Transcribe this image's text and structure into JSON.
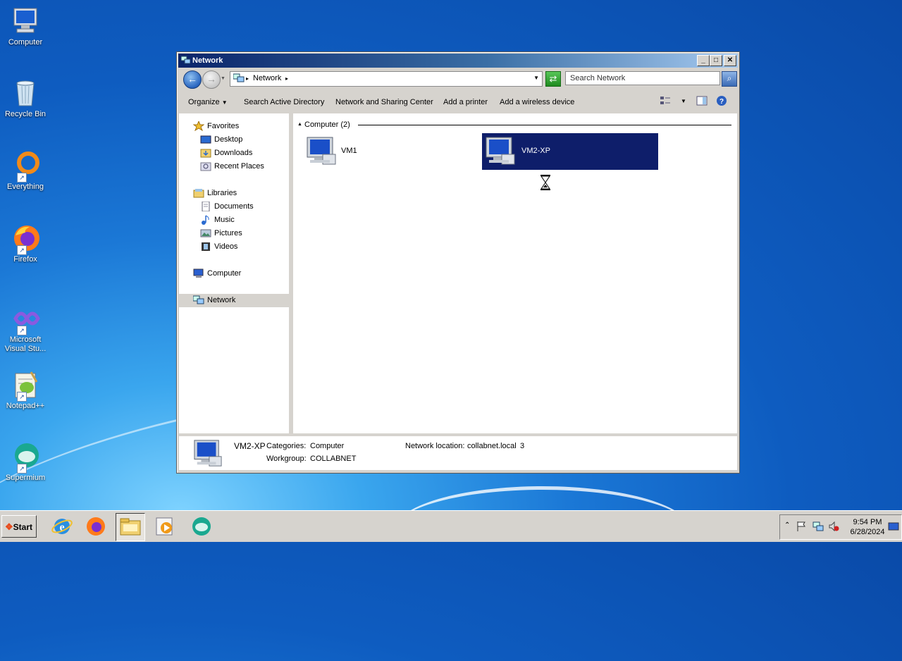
{
  "desktop": {
    "icons": [
      {
        "label": "Computer"
      },
      {
        "label": "Recycle Bin"
      },
      {
        "label": "Everything"
      },
      {
        "label": "Firefox"
      },
      {
        "label": "Microsoft Visual Stu..."
      },
      {
        "label": "Notepad++"
      },
      {
        "label": "Supermium"
      }
    ]
  },
  "window": {
    "title": "Network",
    "controls": {
      "minimize": "_",
      "maximize": "□",
      "close": "✕"
    },
    "address": {
      "breadcrumb": "Network",
      "search_placeholder": "Search Network"
    },
    "toolbar": {
      "organize": "Organize",
      "search_ad": "Search Active Directory",
      "sharing_center": "Network and Sharing Center",
      "add_printer": "Add a printer",
      "add_wireless": "Add a wireless device"
    },
    "navpane": {
      "favorites": "Favorites",
      "desktop": "Desktop",
      "downloads": "Downloads",
      "recent": "Recent Places",
      "libraries": "Libraries",
      "documents": "Documents",
      "music": "Music",
      "pictures": "Pictures",
      "videos": "Videos",
      "computer": "Computer",
      "network": "Network"
    },
    "main": {
      "group_header": "Computer (2)",
      "items": [
        {
          "label": "VM1",
          "selected": false
        },
        {
          "label": "VM2-XP",
          "selected": true
        }
      ]
    },
    "details": {
      "name": "VM2-XP",
      "categories_label": "Categories:",
      "categories_value": "Computer",
      "workgroup_label": "Workgroup:",
      "workgroup_value": "COLLABNET",
      "location_label": "Network location:",
      "location_value": "collabnet.local",
      "location_extra": "3"
    }
  },
  "taskbar": {
    "start_label": "Start",
    "apps": [
      "internet-explorer",
      "firefox",
      "file-explorer",
      "media-player",
      "supermium"
    ],
    "clock": {
      "time": "9:54 PM",
      "date": "6/28/2024"
    }
  }
}
